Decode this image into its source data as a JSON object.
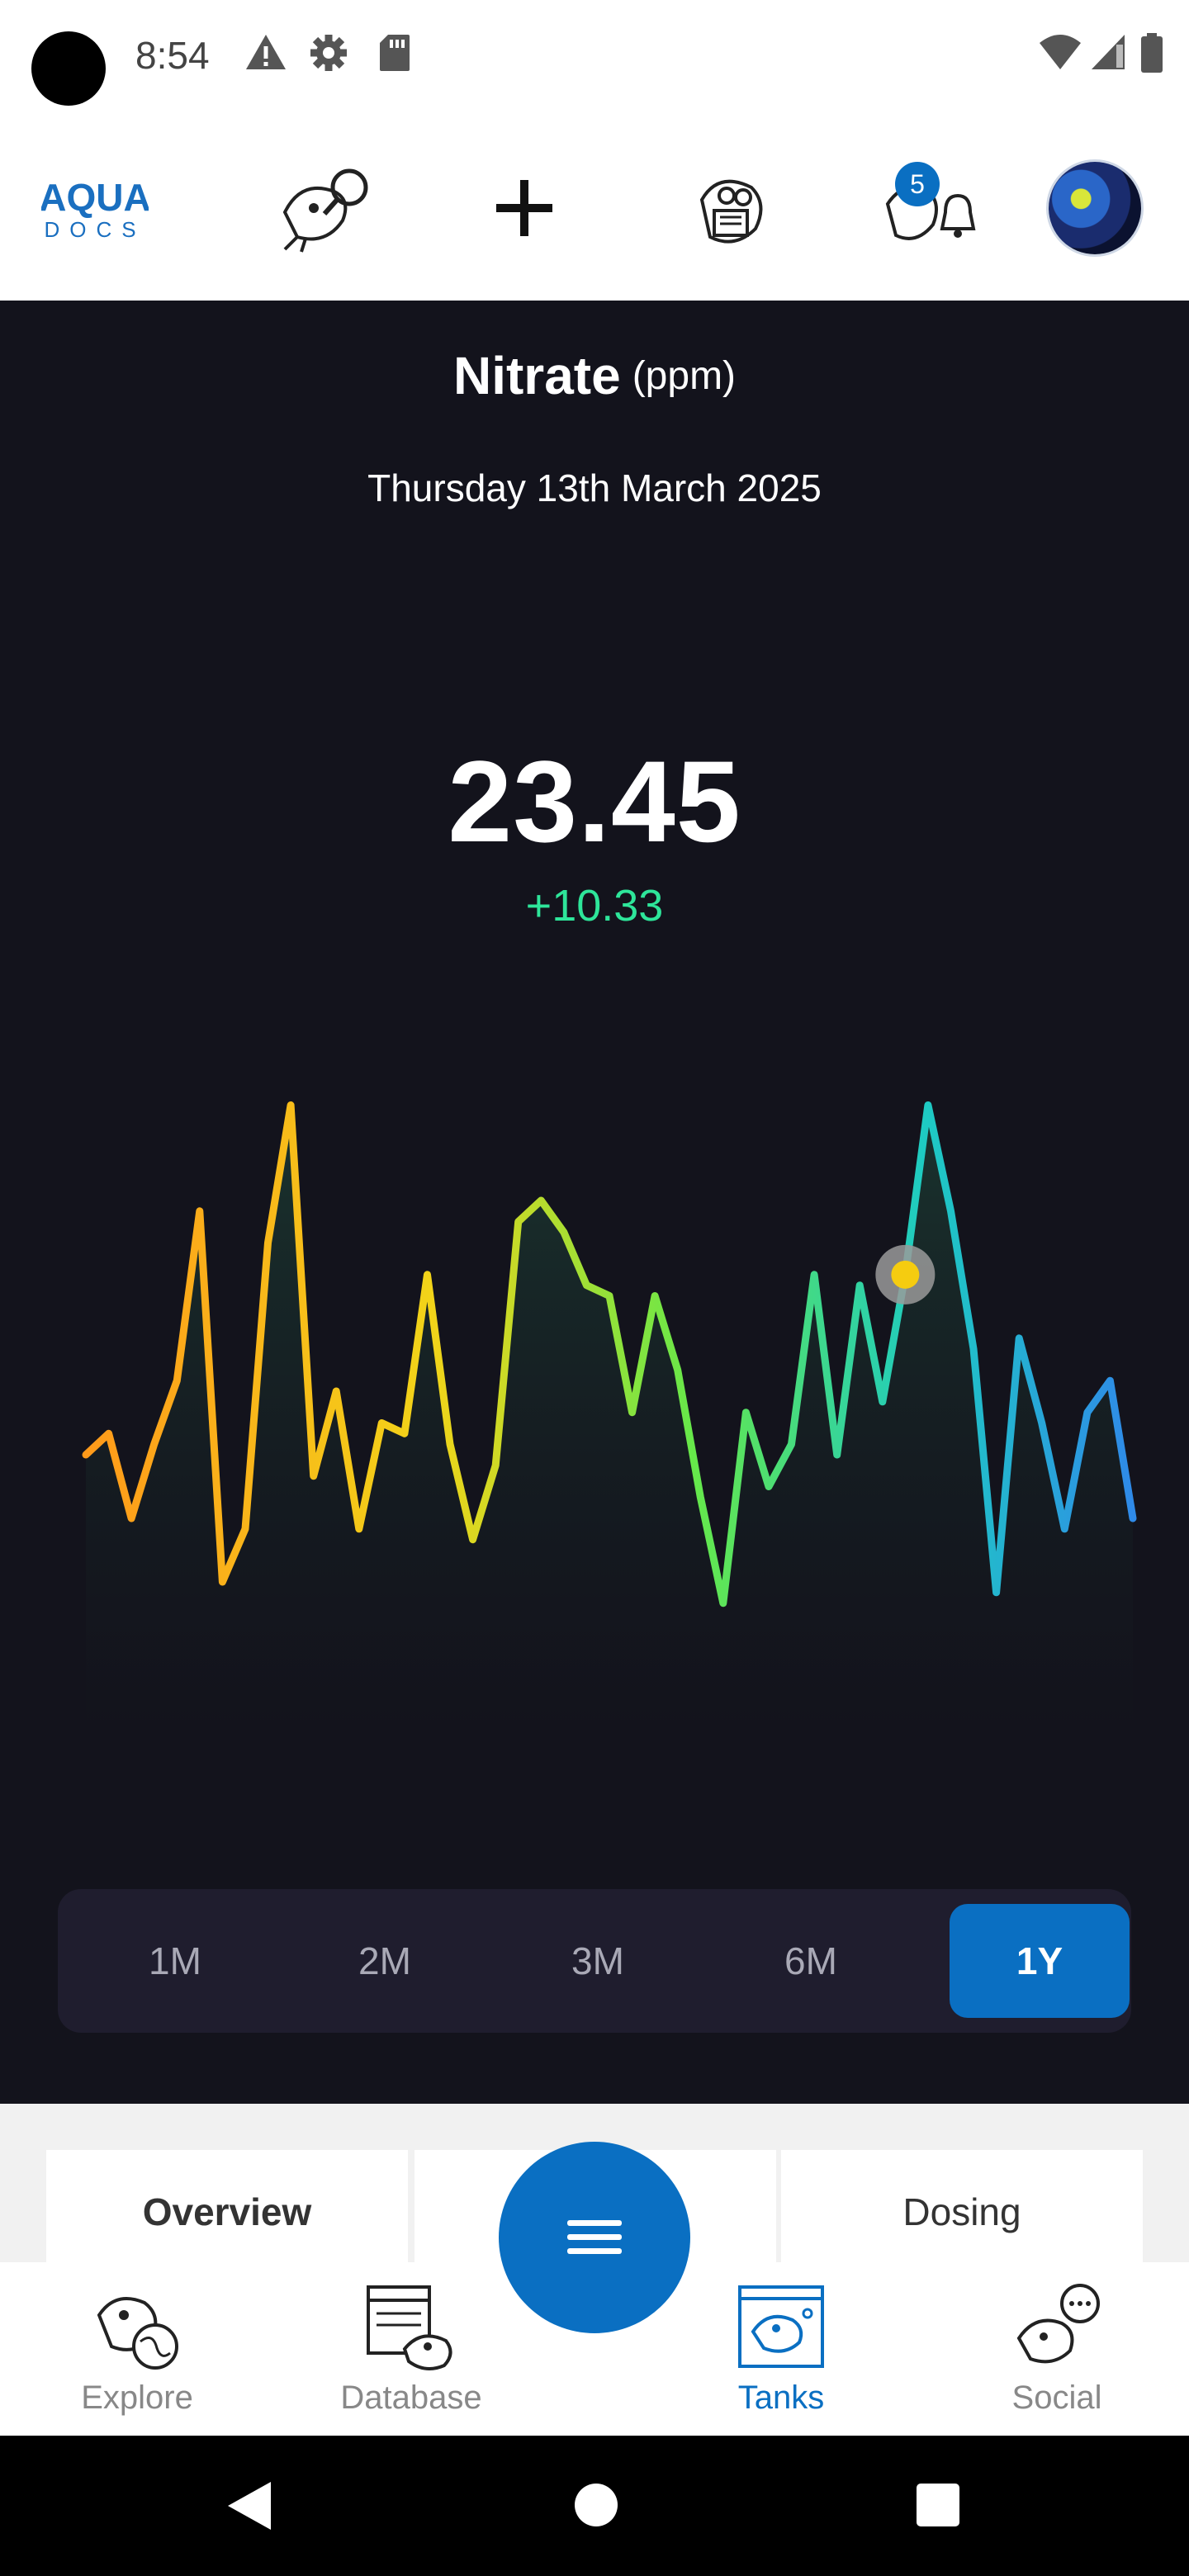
{
  "status_bar": {
    "time": "8:54",
    "icons": [
      "camera-cutout",
      "warning-icon",
      "settings-icon",
      "sd-card-icon",
      "wifi-icon",
      "signal-icon",
      "battery-icon"
    ]
  },
  "top_nav": {
    "logo_text_top": "AQUA",
    "logo_text_bottom": "DOCS",
    "items": [
      "fish-search-icon",
      "add-icon",
      "fish-reading-icon",
      "fish-bell-icon",
      "profile-avatar"
    ],
    "notification_count": "5"
  },
  "metric": {
    "title": "Nitrate",
    "unit": "(ppm)",
    "date": "Thursday 13th March 2025",
    "value": "23.45",
    "delta": "+10.33"
  },
  "chart_data": {
    "type": "line",
    "y": [
      24,
      26,
      18,
      25,
      31,
      47,
      12,
      17,
      44,
      57,
      22,
      30,
      17,
      27,
      26,
      41,
      25,
      16,
      23,
      46,
      48,
      45,
      40,
      39,
      28,
      39,
      32,
      20,
      10,
      28,
      21,
      25,
      41,
      24,
      40,
      29,
      41,
      57,
      47,
      34,
      11,
      35,
      27,
      17,
      28,
      31,
      18
    ],
    "highlight_index": 36,
    "ylim": [
      0,
      60
    ],
    "title": "",
    "xlabel": "",
    "ylabel": "",
    "grid": false,
    "colors": {
      "start": "#ff9a1a",
      "mid_yellow": "#f2d419",
      "green": "#66e84a",
      "teal": "#1ecbc2",
      "end": "#2f8ae8"
    }
  },
  "range_selector": {
    "options": [
      "1M",
      "2M",
      "3M",
      "6M",
      "1Y"
    ],
    "selected": "1Y"
  },
  "tabs": {
    "left": "Overview",
    "right": "Dosing"
  },
  "bottom_nav": {
    "items": [
      {
        "label": "Explore",
        "icon": "fish-globe-icon"
      },
      {
        "label": "Database",
        "icon": "fish-database-icon"
      },
      {
        "label": "Tanks",
        "icon": "fish-tank-icon"
      },
      {
        "label": "Social",
        "icon": "fish-chat-icon"
      }
    ],
    "active": "Tanks"
  },
  "accent_color": "#0a6fc2"
}
